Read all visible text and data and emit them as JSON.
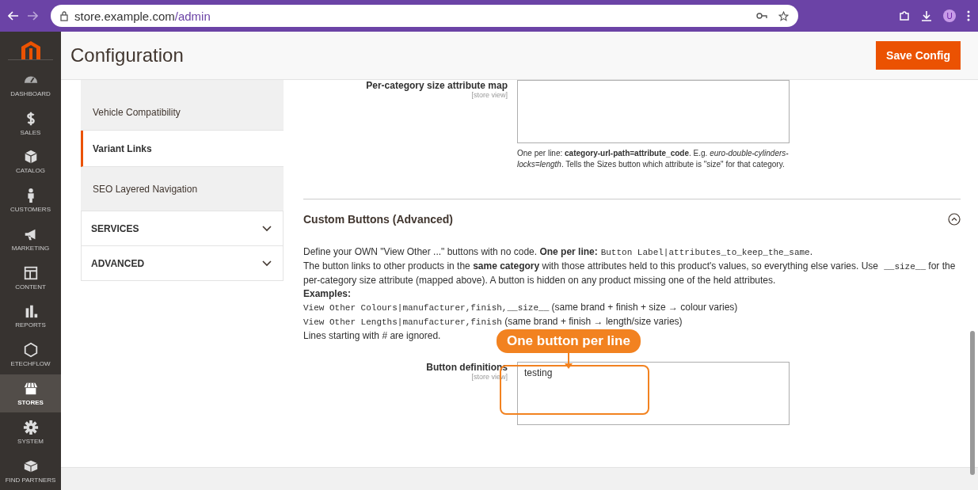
{
  "browser": {
    "url_host": "store.example.com",
    "url_path": "/admin",
    "profile_initial": "U"
  },
  "nav": [
    {
      "label": "DASHBOARD",
      "selected": false
    },
    {
      "label": "SALES",
      "selected": false
    },
    {
      "label": "CATALOG",
      "selected": false
    },
    {
      "label": "CUSTOMERS",
      "selected": false
    },
    {
      "label": "MARKETING",
      "selected": false
    },
    {
      "label": "CONTENT",
      "selected": false
    },
    {
      "label": "REPORTS",
      "selected": false
    },
    {
      "label": "ETECHFLOW",
      "selected": false
    },
    {
      "label": "STORES",
      "selected": true
    },
    {
      "label": "SYSTEM",
      "selected": false
    },
    {
      "label": "FIND PARTNERS",
      "selected": false
    }
  ],
  "page": {
    "title": "Configuration",
    "save_button": "Save Config"
  },
  "config_tabs": [
    {
      "label": "Vehicle Compatibility",
      "selected": false
    },
    {
      "label": "Variant Links",
      "selected": true
    },
    {
      "label": "SEO Layered Navigation",
      "selected": false
    }
  ],
  "config_groups": [
    {
      "label": "SERVICES",
      "expanded": false
    },
    {
      "label": "ADVANCED",
      "expanded": false
    }
  ],
  "size_map_field": {
    "label": "Per-category size attribute map",
    "scope": "[store view]",
    "note": [
      {
        "kind": "plain",
        "text": "One per line: "
      },
      {
        "kind": "bold",
        "text": "category-url-path=attribute_code"
      },
      {
        "kind": "plain",
        "text": ". E.g. "
      },
      {
        "kind": "italic",
        "text": "euro-double-cylinders-locks=length"
      },
      {
        "kind": "plain",
        "text": ". Tells the Sizes button which attribute is \"size\" for that category."
      }
    ]
  },
  "section": {
    "title": "Custom Buttons (Advanced)",
    "expanded": true,
    "description": [
      [
        {
          "kind": "plain",
          "text": "Define your OWN \"View Other ...\" buttons with no code. "
        },
        {
          "kind": "bold",
          "text": "One per line:"
        },
        {
          "kind": "code",
          "text": "Button Label|attributes_to_keep_the_same"
        },
        {
          "kind": "plain",
          "text": "."
        }
      ],
      [
        {
          "kind": "plain",
          "text": "The button links to other products in the "
        },
        {
          "kind": "bold",
          "text": "same category"
        },
        {
          "kind": "plain",
          "text": " with those attributes held to this product's values, so everything else varies. Use "
        },
        {
          "kind": "code",
          "text": "__size__"
        },
        {
          "kind": "plain",
          "text": " for the per-category size attribute (mapped above). A button is hidden on any product missing one of the held attributes."
        }
      ],
      [
        {
          "kind": "bold",
          "text": "Examples:"
        }
      ],
      [
        {
          "kind": "code",
          "text": "View Other Colours|manufacturer,finish,__size__"
        },
        {
          "kind": "plain",
          "text": " (same brand + finish + size → colour varies)"
        }
      ],
      [
        {
          "kind": "code",
          "text": "View Other Lengths|manufacturer,finish"
        },
        {
          "kind": "plain",
          "text": " (same brand + finish → length/size varies)"
        }
      ],
      [
        {
          "kind": "plain",
          "text": "Lines starting with # are ignored."
        }
      ]
    ]
  },
  "button_definitions_field": {
    "label": "Button definitions",
    "scope": "[store view]",
    "value": "testing"
  },
  "annotation": {
    "text": "One button per line"
  }
}
